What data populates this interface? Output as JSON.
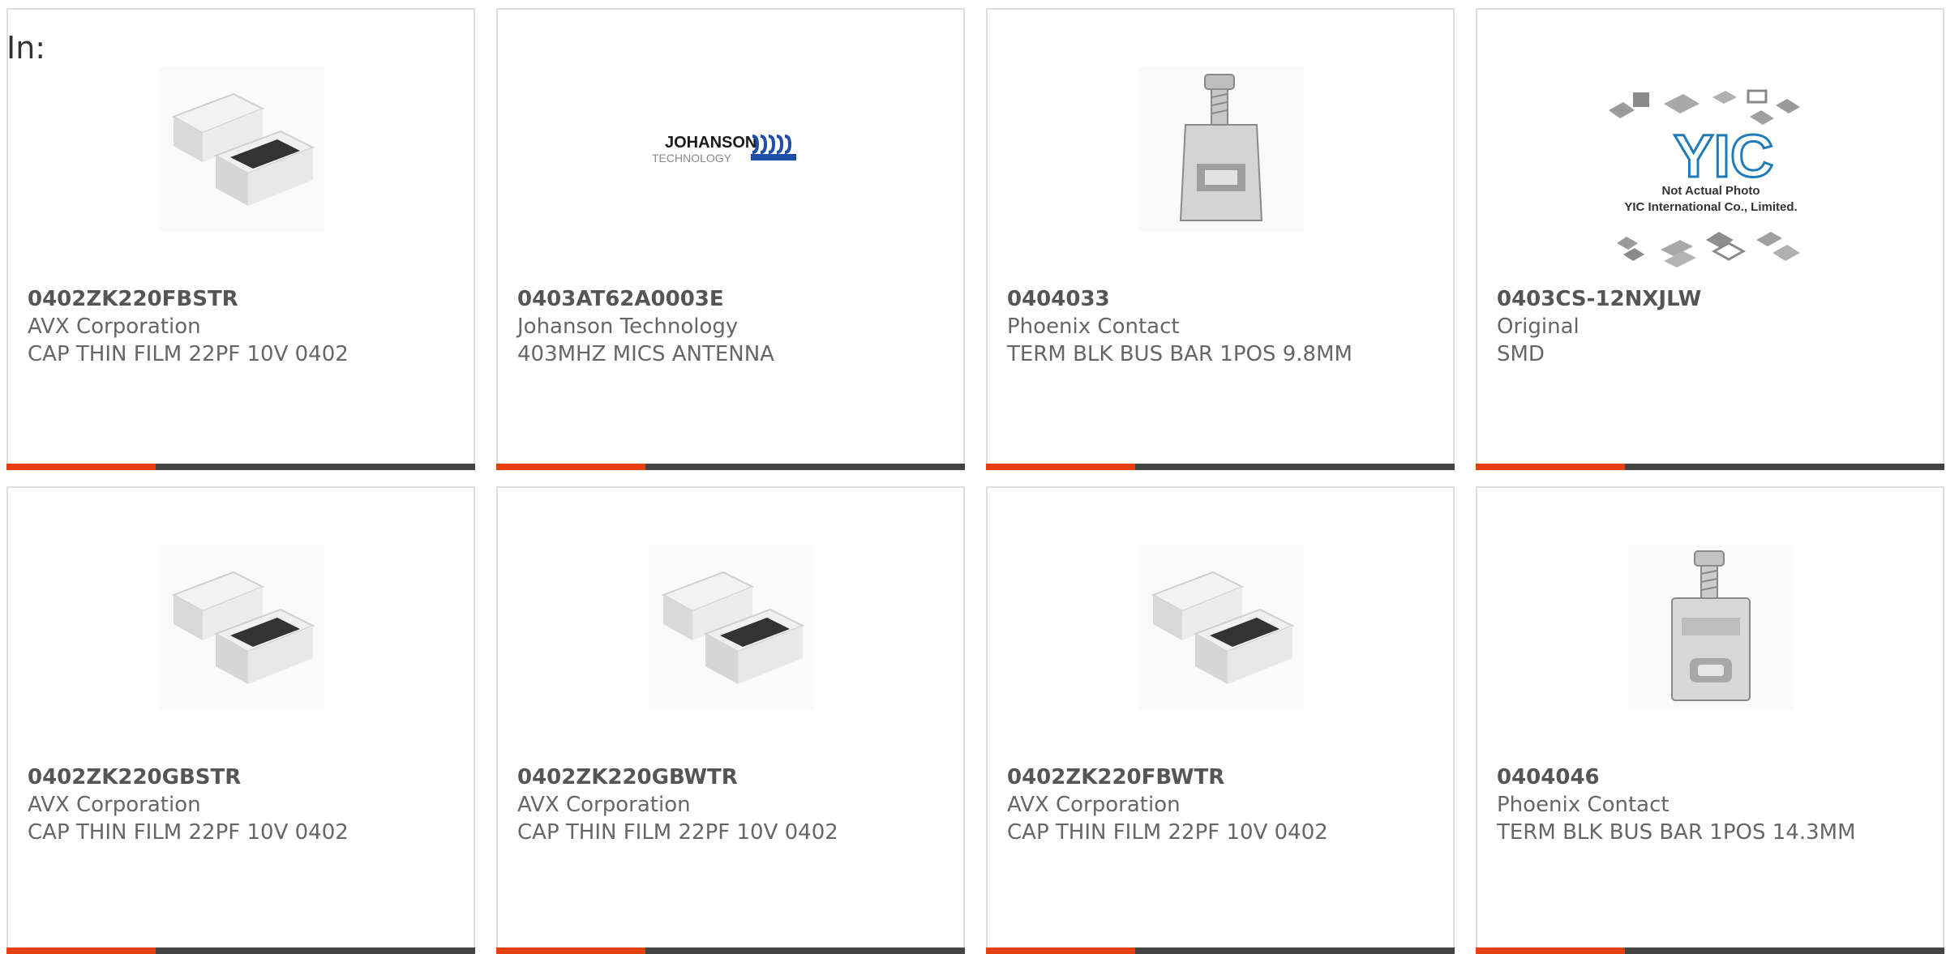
{
  "filter_label": "In:",
  "colors": {
    "accent": "#e6400f",
    "bar": "#444444",
    "border": "#dedede"
  },
  "products": [
    {
      "part": "0402ZK220FBSTR",
      "manufacturer": "AVX Corporation",
      "description": "CAP THIN FILM 22PF 10V 0402",
      "image": "capacitor-chip"
    },
    {
      "part": "0403AT62A0003E",
      "manufacturer": "Johanson Technology",
      "description": "403MHZ MICS ANTENNA",
      "image": "johanson-logo",
      "logo_text": "JOHANSON",
      "logo_sub": "TECHNOLOGY"
    },
    {
      "part": "0404033",
      "manufacturer": "Phoenix Contact",
      "description": "TERM BLK BUS BAR 1POS 9.8MM",
      "image": "bus-bar-terminal"
    },
    {
      "part": "0403CS-12NXJLW",
      "manufacturer": "Original",
      "description": "SMD",
      "image": "yic-placeholder",
      "logo_text": "YIC",
      "photo_note": "Not Actual Photo",
      "photo_company": "YIC International Co., Limited."
    },
    {
      "part": "0402ZK220GBSTR",
      "manufacturer": "AVX Corporation",
      "description": "CAP THIN FILM 22PF 10V 0402",
      "image": "capacitor-chip"
    },
    {
      "part": "0402ZK220GBWTR",
      "manufacturer": "AVX Corporation",
      "description": "CAP THIN FILM 22PF 10V 0402",
      "image": "capacitor-chip"
    },
    {
      "part": "0402ZK220FBWTR",
      "manufacturer": "AVX Corporation",
      "description": "CAP THIN FILM 22PF 10V 0402",
      "image": "capacitor-chip"
    },
    {
      "part": "0404046",
      "manufacturer": "Phoenix Contact",
      "description": "TERM BLK BUS BAR 1POS 14.3MM",
      "image": "bus-bar-terminal"
    }
  ]
}
